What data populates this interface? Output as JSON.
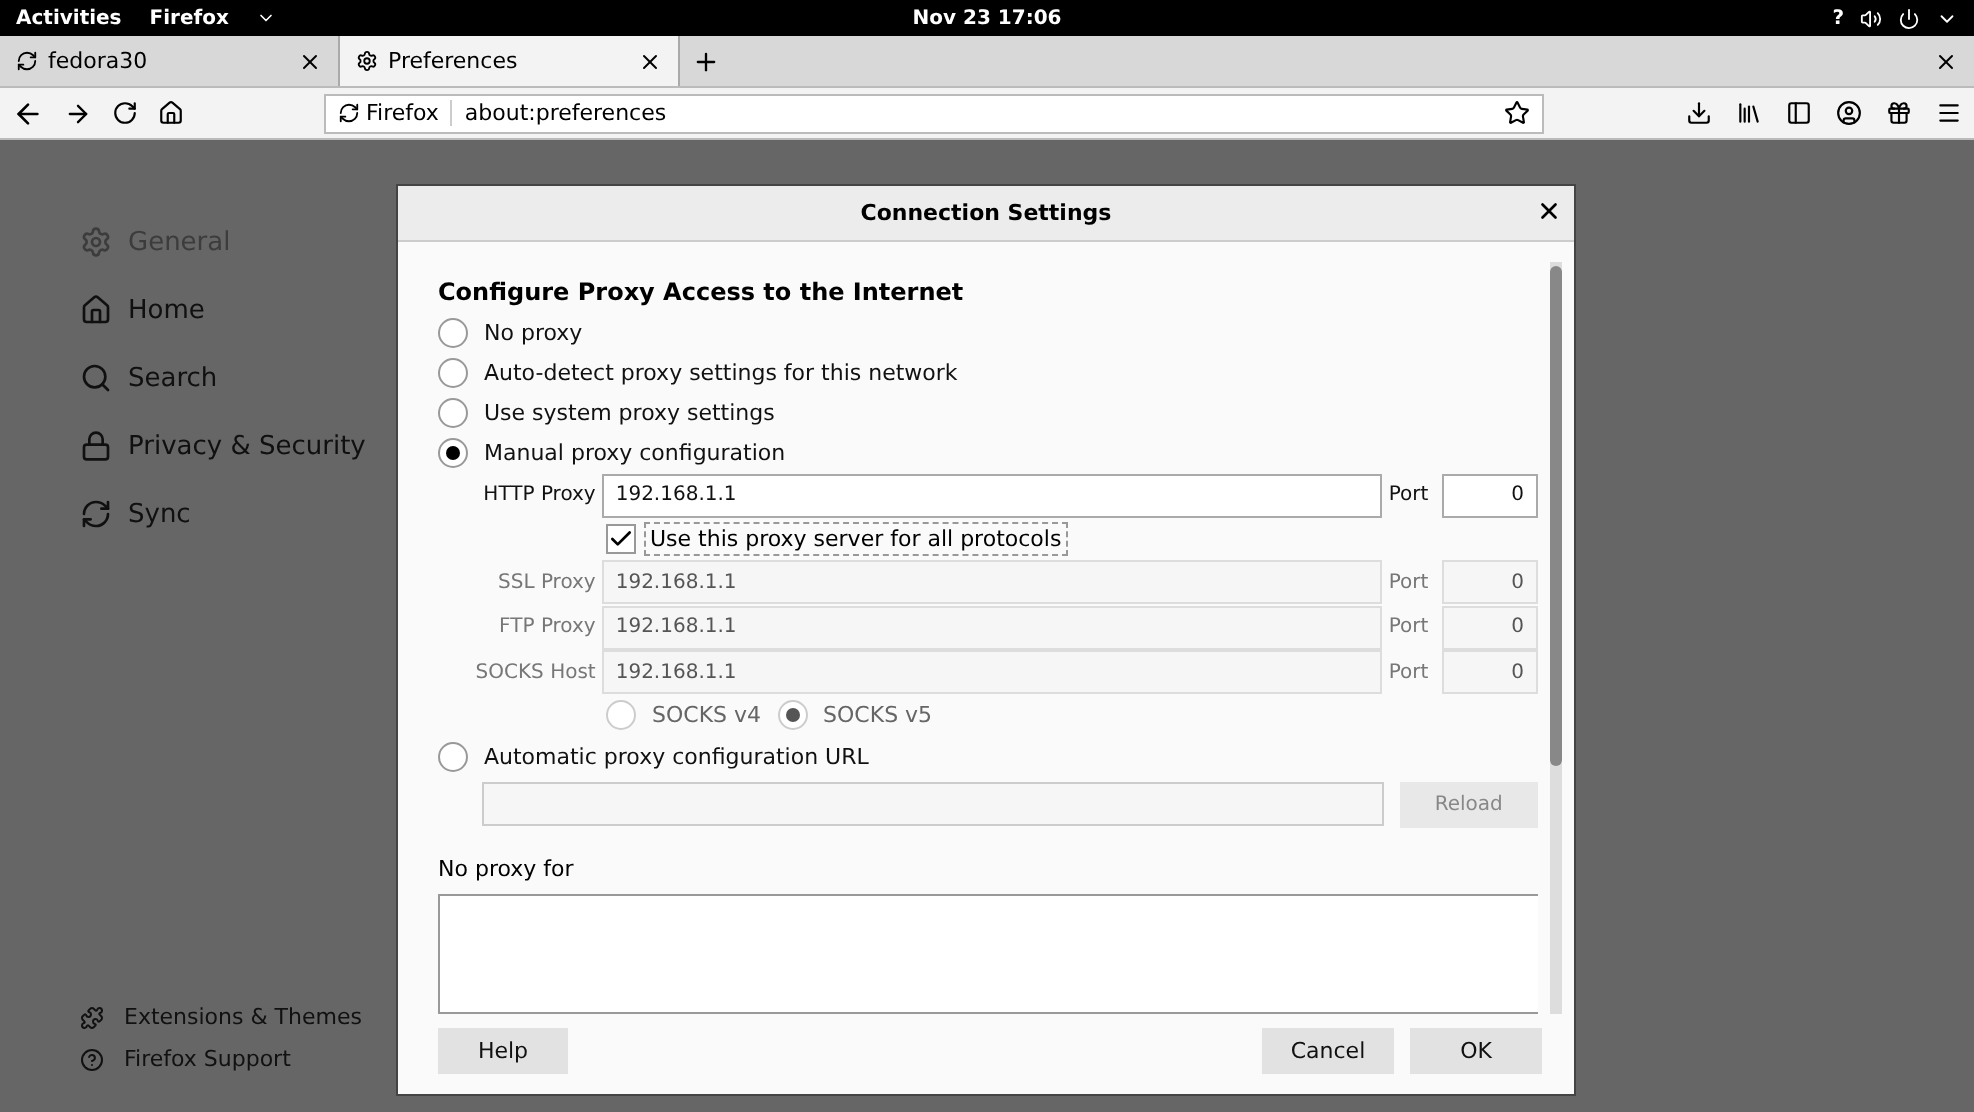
{
  "top_bar": {
    "activities": "Activities",
    "app_menu": "Firefox",
    "clock": "Nov 23 17:06",
    "help": "?"
  },
  "tabs": [
    {
      "label": "fedora30",
      "selected": false
    },
    {
      "label": "Preferences",
      "selected": true
    }
  ],
  "url_bar": {
    "identity": "Firefox",
    "url": "about:preferences"
  },
  "sidebar": {
    "items": [
      {
        "label": "General",
        "selected": true
      },
      {
        "label": "Home",
        "selected": false
      },
      {
        "label": "Search",
        "selected": false
      },
      {
        "label": "Privacy & Security",
        "selected": false
      },
      {
        "label": "Sync",
        "selected": false
      }
    ],
    "footer": [
      "Extensions & Themes",
      "Firefox Support"
    ]
  },
  "dialog": {
    "title": "Connection Settings",
    "heading": "Configure Proxy Access to the Internet",
    "proxy_modes": [
      {
        "label": "No proxy",
        "selected": false
      },
      {
        "label": "Auto-detect proxy settings for this network",
        "selected": false
      },
      {
        "label": "Use system proxy settings",
        "selected": false
      },
      {
        "label": "Manual proxy configuration",
        "selected": true
      }
    ],
    "proxies": [
      {
        "label": "HTTP Proxy",
        "value": "192.168.1.1",
        "port_label": "Port",
        "port": "0",
        "disabled": false
      },
      {
        "label": "SSL Proxy",
        "value": "192.168.1.1",
        "port_label": "Port",
        "port": "0",
        "disabled": true
      },
      {
        "label": "FTP Proxy",
        "value": "192.168.1.1",
        "port_label": "Port",
        "port": "0",
        "disabled": true
      },
      {
        "label": "SOCKS Host",
        "value": "192.168.1.1",
        "port_label": "Port",
        "port": "0",
        "disabled": true
      }
    ],
    "share": {
      "label": "Use this proxy server for all protocols",
      "checked": true
    },
    "socks_versions": [
      {
        "label": "SOCKS v4",
        "selected": false
      },
      {
        "label": "SOCKS v5",
        "selected": true
      }
    ],
    "auto_config": {
      "label": "Automatic proxy configuration URL",
      "selected": false,
      "reload": "Reload"
    },
    "no_proxy_label": "No proxy for",
    "buttons": {
      "help": "Help",
      "cancel": "Cancel",
      "ok": "OK"
    }
  }
}
